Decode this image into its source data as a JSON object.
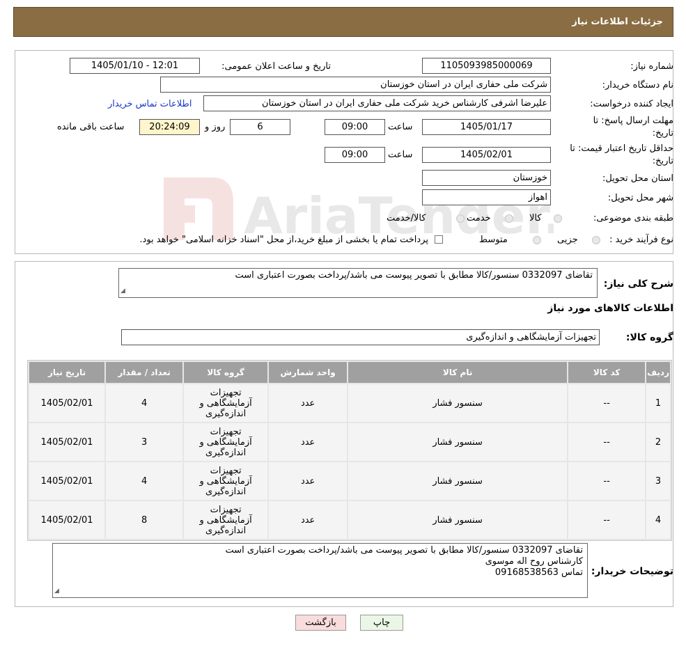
{
  "header": {
    "title": "جزئیات اطلاعات نیاز"
  },
  "form": {
    "need_number_label": "شماره نیاز:",
    "need_number": "1105093985000069",
    "announce_label": "تاریخ و ساعت اعلان عمومی:",
    "announce_value": "1405/01/10 - 12:01",
    "buyer_label": "نام دستگاه خریدار:",
    "buyer_value": "شرکت ملی حفاری ایران در استان خوزستان",
    "creator_label": "ایجاد کننده درخواست:",
    "creator_value": "علیرضا اشرفی کارشناس خرید شرکت ملی حفاری ایران در استان خوزستان",
    "contact_link": "اطلاعات تماس خریدار",
    "deadline_label_1": "مهلت ارسال پاسخ: تا",
    "deadline_label_2": "تاریخ:",
    "deadline_date": "1405/01/17",
    "time_label": "ساعت",
    "deadline_time": "09:00",
    "days_value": "6",
    "days_label": "روز و",
    "remaining_time": "20:24:09",
    "remaining_label": "ساعت باقی مانده",
    "validity_label_1": "حداقل تاریخ اعتبار قیمت: تا",
    "validity_label_2": "تاریخ:",
    "validity_date": "1405/02/01",
    "validity_time": "09:00",
    "province_label": "استان محل تحویل:",
    "province_value": "خوزستان",
    "city_label": "شهر محل تحویل:",
    "city_value": "اهواز",
    "category_label": "طبقه بندی موضوعی:",
    "category_options": [
      "کالا",
      "خدمت",
      "کالا/خدمت"
    ],
    "process_label": "نوع فرآیند خرید :",
    "process_options": [
      "جزیی",
      "متوسط"
    ],
    "process_note": "پرداخت تمام یا بخشی از مبلغ خرید،از محل \"اسناد خزانه اسلامی\" خواهد بود."
  },
  "description": {
    "label": "شرح کلی نیاز:",
    "value": "تقاضای 0332097 سنسور/کالا مطابق با تصویر پیوست می باشد/پرداخت بصورت اعتباری است",
    "goods_info_title": "اطلاعات کالاهای مورد نیاز",
    "group_label": "گروه کالا:",
    "group_value": "تجهیزات آزمایشگاهی و اندازه‌گیری"
  },
  "table": {
    "headers": [
      "ردیف",
      "کد کالا",
      "نام کالا",
      "واحد شمارش",
      "گروه کالا",
      "تعداد / مقدار",
      "تاریخ نیاز"
    ],
    "rows": [
      {
        "row": "1",
        "code": "--",
        "name": "سنسور فشار",
        "unit": "عدد",
        "group": "تجهیزات آزمایشگاهی و اندازه‌گیری",
        "qty": "4",
        "date": "1405/02/01"
      },
      {
        "row": "2",
        "code": "--",
        "name": "سنسور فشار",
        "unit": "عدد",
        "group": "تجهیزات آزمایشگاهی و اندازه‌گیری",
        "qty": "3",
        "date": "1405/02/01"
      },
      {
        "row": "3",
        "code": "--",
        "name": "سنسور فشار",
        "unit": "عدد",
        "group": "تجهیزات آزمایشگاهی و اندازه‌گیری",
        "qty": "4",
        "date": "1405/02/01"
      },
      {
        "row": "4",
        "code": "--",
        "name": "سنسور فشار",
        "unit": "عدد",
        "group": "تجهیزات آزمایشگاهی و اندازه‌گیری",
        "qty": "8",
        "date": "1405/02/01"
      }
    ]
  },
  "buyer_notes": {
    "label": "توضیحات خریدار:",
    "lines": [
      "تقاضای 0332097 سنسور/کالا مطابق با تصویر پیوست می باشد/پرداخت بصورت اعتباری است",
      "کارشناس روح اله موسوی",
      "تماس 09168538563"
    ]
  },
  "buttons": {
    "print": "چاپ",
    "back": "بازگشت"
  },
  "watermark": {
    "text": "AriaTender.neT"
  },
  "colors": {
    "header_bg": "#8a6d43",
    "link": "#1a37c6",
    "print_btn": "#eaf7e6",
    "back_btn": "#f9dcdc"
  }
}
